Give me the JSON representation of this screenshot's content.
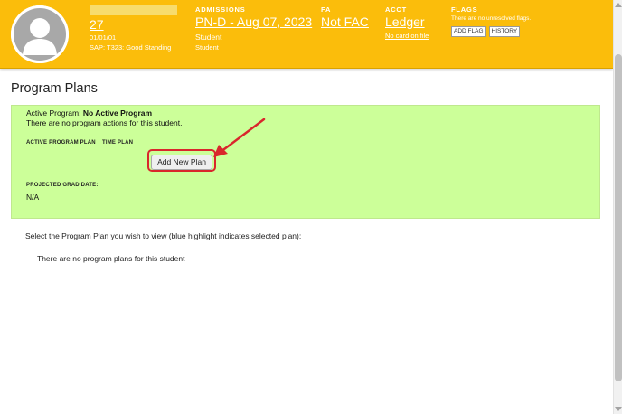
{
  "header": {
    "student_id": "27",
    "dob": "01/01/01",
    "sap": "SAP: T323: Good Standing",
    "admissions": {
      "title": "ADMISSIONS",
      "link": "PN-D - Aug 07, 2023",
      "line1": "Student",
      "line2": "Student"
    },
    "fa": {
      "title": "FA",
      "link": "Not FAC"
    },
    "acct": {
      "title": "ACCT",
      "link": "Ledger",
      "card": "No card on file"
    },
    "flags": {
      "title": "FLAGS",
      "note": "There are no unresolved flags.",
      "add_flag": "ADD FLAG",
      "history": "HISTORY"
    }
  },
  "page_title": "Program Plans",
  "panel": {
    "active_label": "Active Program: ",
    "active_value": "No Active Program",
    "no_actions": "There are no program actions for this student.",
    "active_plan_label": "ACTIVE PROGRAM PLAN",
    "time_plan_label": "TIME PLAN",
    "add_plan_button": "Add New Plan",
    "grad_label": "PROJECTED GRAD DATE:",
    "grad_value": "N/A"
  },
  "select_text": "Select the Program Plan you wish to view (blue highlight indicates selected plan):",
  "no_plans_text": "There are no program plans for this student",
  "colors": {
    "header_bg": "#fbbd0b",
    "panel_bg": "#ccff99",
    "highlight": "#d9262c"
  }
}
